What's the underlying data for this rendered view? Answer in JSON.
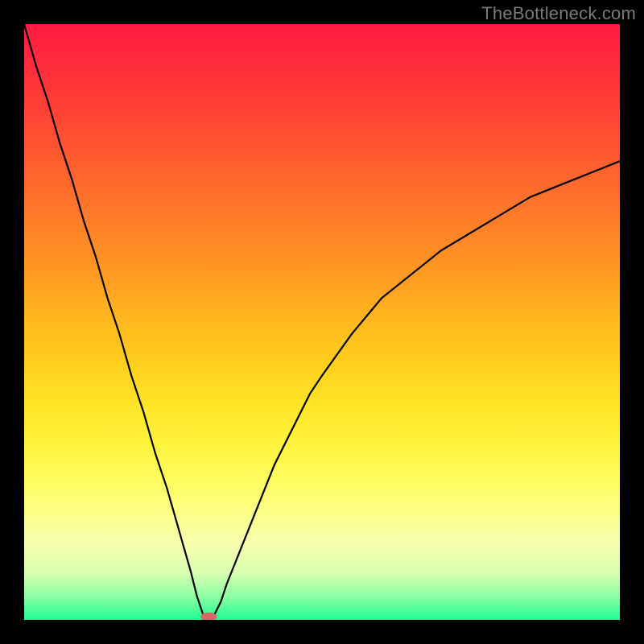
{
  "watermark": {
    "text": "TheBottleneck.com"
  },
  "chart_data": {
    "type": "line",
    "title": "",
    "xlabel": "",
    "ylabel": "",
    "xlim": [
      0,
      100
    ],
    "ylim": [
      0,
      100
    ],
    "grid": false,
    "series": [
      {
        "name": "bottleneck-curve",
        "x": [
          0,
          2,
          4,
          6,
          8,
          10,
          12,
          14,
          16,
          18,
          20,
          22,
          24,
          26,
          28,
          29,
          30,
          31,
          32,
          33,
          34,
          36,
          38,
          40,
          42,
          44,
          46,
          48,
          50,
          55,
          60,
          65,
          70,
          75,
          80,
          85,
          90,
          95,
          100
        ],
        "y": [
          100,
          93,
          87,
          80,
          74,
          67,
          61,
          54,
          48,
          41,
          35,
          28,
          22,
          15,
          8,
          4,
          1,
          0,
          1,
          3,
          6,
          11,
          16,
          21,
          26,
          30,
          34,
          38,
          41,
          48,
          54,
          58,
          62,
          65,
          68,
          71,
          73,
          75,
          77
        ]
      }
    ],
    "minimum_marker": {
      "x": 31,
      "y": 0
    },
    "background_gradient": {
      "top": "#ff1a40",
      "mid": "#fff23a",
      "bottom": "#1fff93"
    }
  }
}
